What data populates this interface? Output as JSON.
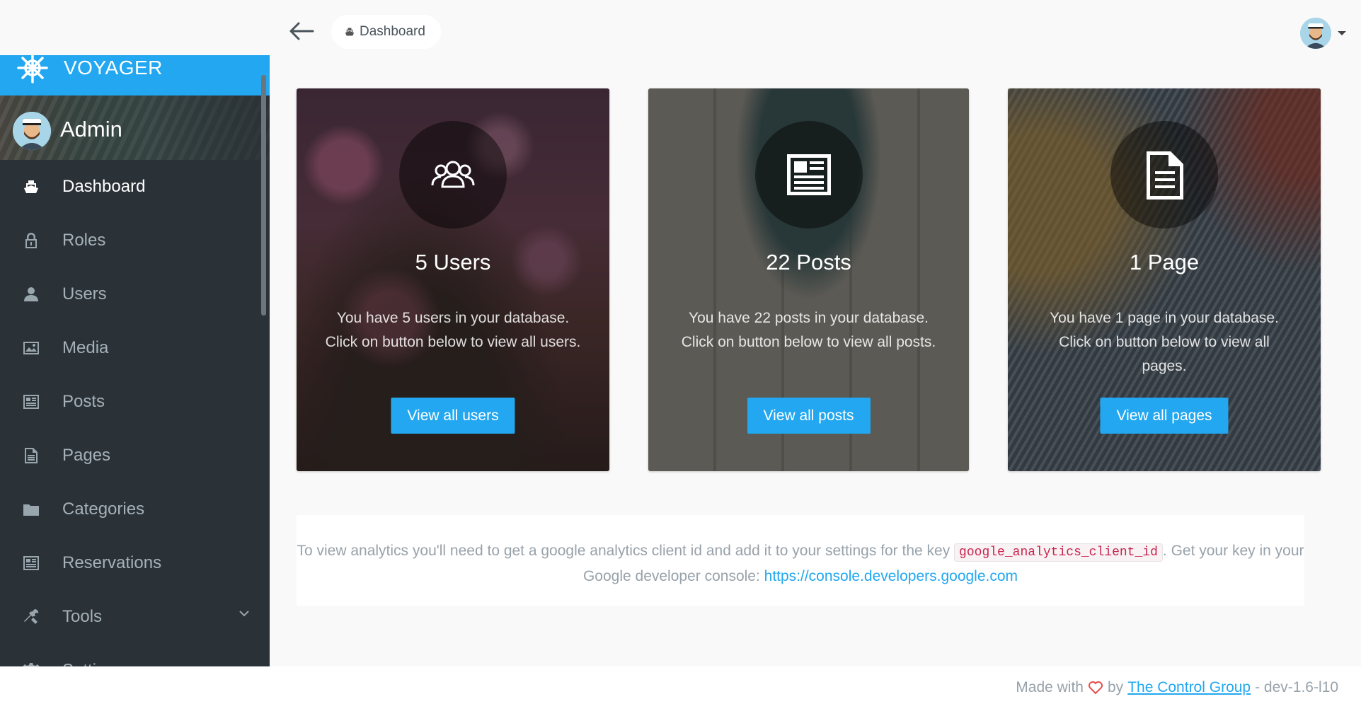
{
  "brand": {
    "title": "VOYAGER",
    "logo_icon": "ship-wheel-icon",
    "color": "#22a7f0"
  },
  "profile": {
    "name": "Admin"
  },
  "sidebar": {
    "items": [
      {
        "label": "Dashboard",
        "icon": "boat-icon",
        "active": true
      },
      {
        "label": "Roles",
        "icon": "lock-icon"
      },
      {
        "label": "Users",
        "icon": "person-icon"
      },
      {
        "label": "Media",
        "icon": "image-icon"
      },
      {
        "label": "Posts",
        "icon": "news-icon"
      },
      {
        "label": "Pages",
        "icon": "file-text-icon"
      },
      {
        "label": "Categories",
        "icon": "folder-icon"
      },
      {
        "label": "Reservations",
        "icon": "news-icon"
      },
      {
        "label": "Tools",
        "icon": "tools-icon"
      },
      {
        "label": "Settings",
        "icon": "gear-icon"
      }
    ]
  },
  "header": {
    "breadcrumb": "Dashboard",
    "back_icon": "arrow-left-icon"
  },
  "cards": [
    {
      "title": "5 Users",
      "text": "You have 5 users in your database. Click on button below to view all users.",
      "button": "View all users",
      "icon": "group-icon"
    },
    {
      "title": "22 Posts",
      "text": "You have 22 posts in your database. Click on button below to view all posts.",
      "button": "View all posts",
      "icon": "news-icon"
    },
    {
      "title": "1 Page",
      "text": "You have 1 page in your database. Click on button below to view all pages.",
      "button": "View all pages",
      "icon": "file-text-icon"
    }
  ],
  "analytics": {
    "text_before": "To view analytics you'll need to get a google analytics client id and add it to your settings for the key ",
    "code": "google_analytics_client_id",
    "text_after": ". Get your key in your Google developer console: ",
    "link": "https://console.developers.google.com"
  },
  "footer": {
    "made_with": "Made with",
    "by": "by",
    "company": "The Control Group",
    "version": "- dev-1.6-l10"
  }
}
